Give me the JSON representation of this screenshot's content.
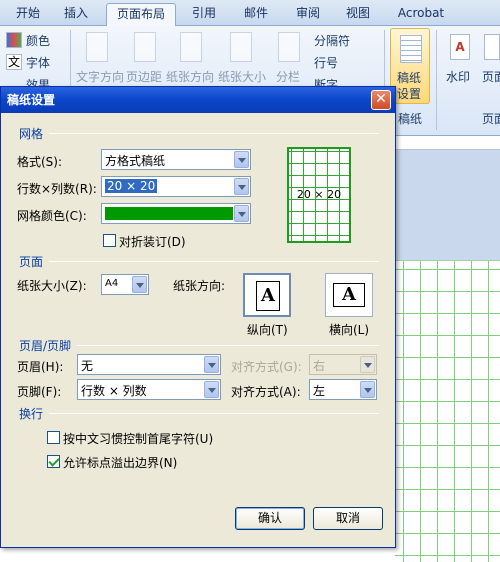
{
  "ribbon": {
    "tabs": [
      "开始",
      "插入",
      "页面布局",
      "引用",
      "邮件",
      "审阅",
      "视图",
      "Acrobat"
    ],
    "active_tab": "页面布局",
    "theme_items": [
      "颜色",
      "字体",
      "效果"
    ],
    "page_setup_items": [
      "文字方向",
      "页边距",
      "纸张方向",
      "纸张大小",
      "分栏"
    ],
    "break_items": [
      "分隔符",
      "行号",
      "断字"
    ],
    "big_button_label_1": "稿纸",
    "big_button_label_2": "设置",
    "group_label": "稿纸",
    "watermark": "水印",
    "page_color": "页面",
    "page_bg_group": "页面"
  },
  "dialog": {
    "title": "稿纸设置",
    "close_icon": "✕",
    "grid_section": "网格",
    "format_label": "格式(S):",
    "format_value": "方格式稿纸",
    "rows_cols_label": "行数×列数(R):",
    "rows_cols_value": "20 × 20",
    "grid_color_label": "网格颜色(C):",
    "grid_color": "#009900",
    "fold_label": "对折装订(D)",
    "fold_checked": false,
    "preview_text": "20 × 20",
    "page_section": "页面",
    "paper_size_label": "纸张大小(Z):",
    "paper_size_value": "A4",
    "orientation_label": "纸张方向:",
    "portrait_label": "纵向(T)",
    "landscape_label": "横向(L)",
    "orientation_glyph": "A",
    "header_footer_section": "页眉/页脚",
    "header_label": "页眉(H):",
    "header_value": "无",
    "header_align_label": "对齐方式(G):",
    "header_align_value": "右",
    "footer_label": "页脚(F):",
    "footer_value": "行数 × 列数",
    "footer_align_label": "对齐方式(A):",
    "footer_align_value": "左",
    "linebreak_section": "换行",
    "opt1_label": "按中文习惯控制首尾字符(U)",
    "opt1_checked": false,
    "opt2_label": "允许标点溢出边界(N)",
    "opt2_checked": true,
    "ok_label": "确认",
    "cancel_label": "取消"
  }
}
